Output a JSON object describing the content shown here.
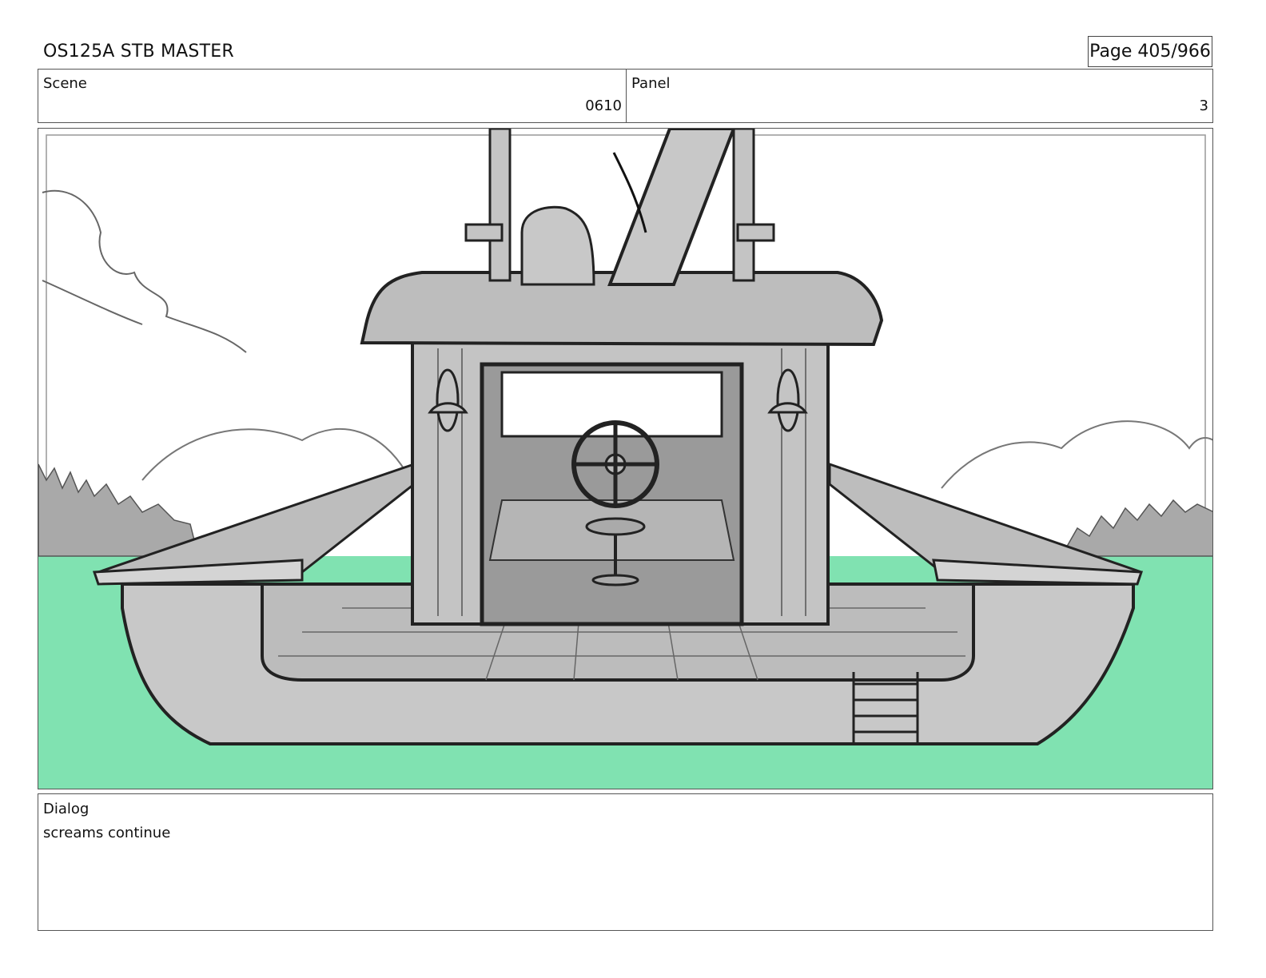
{
  "header": {
    "title": "OS125A  STB MASTER",
    "page": "Page 405/966"
  },
  "scene": {
    "label": "Scene",
    "value": "0610"
  },
  "panel": {
    "label": "Panel",
    "value": "3"
  },
  "dialog": {
    "label": "Dialog",
    "text": "screams continue"
  },
  "colors": {
    "water": "#80e2b1",
    "boat_gray": "#c8c8c8",
    "dark_gray": "#9a9a9a",
    "tree_gray": "#a9a9a9",
    "ink": "#2a2a2a"
  }
}
